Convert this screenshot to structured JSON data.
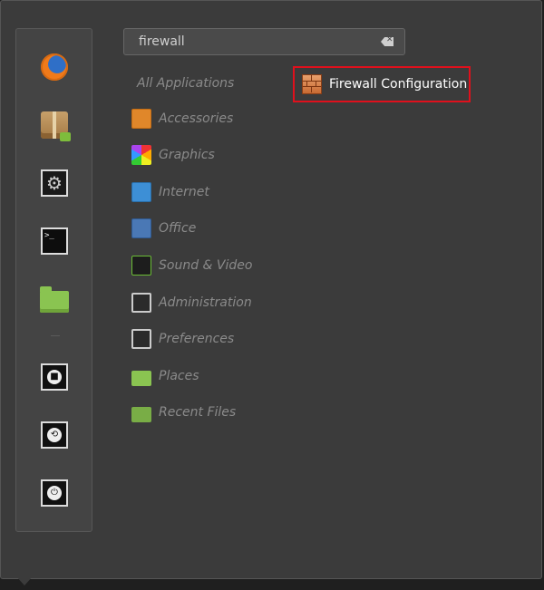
{
  "search": {
    "value": "firewall"
  },
  "favorites": [
    {
      "name": "firefox",
      "icon": "firefox-icon"
    },
    {
      "name": "software-manager",
      "icon": "package-icon"
    },
    {
      "name": "system-settings",
      "icon": "gear-icon"
    },
    {
      "name": "terminal",
      "icon": "terminal-icon",
      "glyph": ">_"
    },
    {
      "name": "files",
      "icon": "folder-icon"
    }
  ],
  "session": [
    {
      "name": "lock-screen",
      "icon": "lock-icon",
      "glyph": "🔒"
    },
    {
      "name": "logout",
      "icon": "logout-icon",
      "glyph": "⟲"
    },
    {
      "name": "shutdown",
      "icon": "power-icon",
      "glyph": "⏻"
    }
  ],
  "categories": {
    "all": "All Applications",
    "items": [
      {
        "label": "Accessories",
        "icon": "accessories-icon"
      },
      {
        "label": "Graphics",
        "icon": "graphics-icon"
      },
      {
        "label": "Internet",
        "icon": "internet-icon"
      },
      {
        "label": "Office",
        "icon": "office-icon"
      },
      {
        "label": "Sound & Video",
        "icon": "sound-video-icon"
      },
      {
        "label": "Administration",
        "icon": "administration-icon"
      },
      {
        "label": "Preferences",
        "icon": "preferences-icon"
      },
      {
        "label": "Places",
        "icon": "places-icon"
      },
      {
        "label": "Recent Files",
        "icon": "recent-files-icon"
      }
    ]
  },
  "results": [
    {
      "label": "Firewall Configuration",
      "icon": "firewall-icon"
    }
  ],
  "colors": {
    "panel_bg": "#3b3b3b",
    "highlight_border": "#e0101c",
    "category_text": "#8a8a8a",
    "result_text": "#ffffff"
  }
}
